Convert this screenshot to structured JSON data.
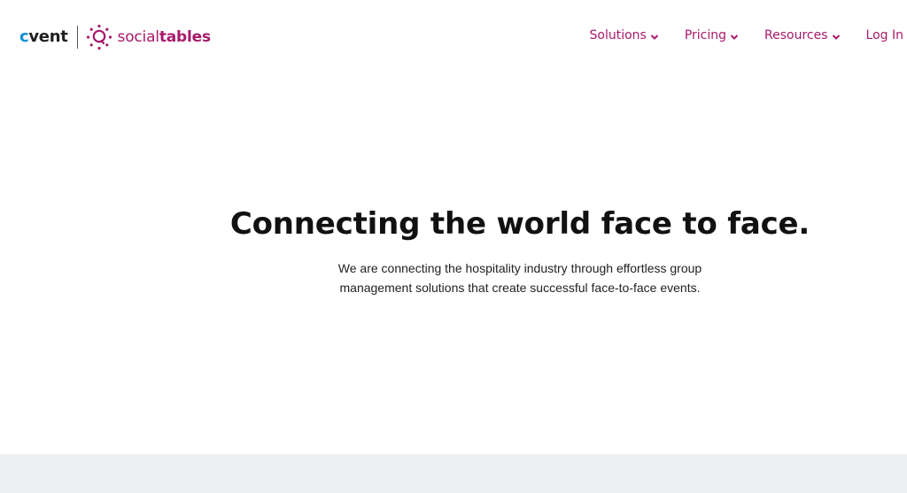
{
  "header": {
    "logo_cvent_c": "c",
    "logo_cvent_rest": "vent",
    "logo_social": "social",
    "logo_tables": "tables",
    "brand_icon": "socialtables-sun-icon"
  },
  "nav": {
    "items": [
      {
        "label": "Solutions",
        "has_dropdown": true
      },
      {
        "label": "Pricing",
        "has_dropdown": true
      },
      {
        "label": "Resources",
        "has_dropdown": true
      },
      {
        "label": "Log In",
        "has_dropdown": false
      }
    ]
  },
  "hero": {
    "title": "Connecting the world face to face.",
    "subtitle_line1": "We are connecting the hospitality industry through effortless group",
    "subtitle_line2": "management solutions that create successful face-to-face events."
  },
  "colors": {
    "brand_magenta": "#a8196b",
    "cvent_blue": "#0a8fd6",
    "footer_band": "#eeeff1"
  }
}
